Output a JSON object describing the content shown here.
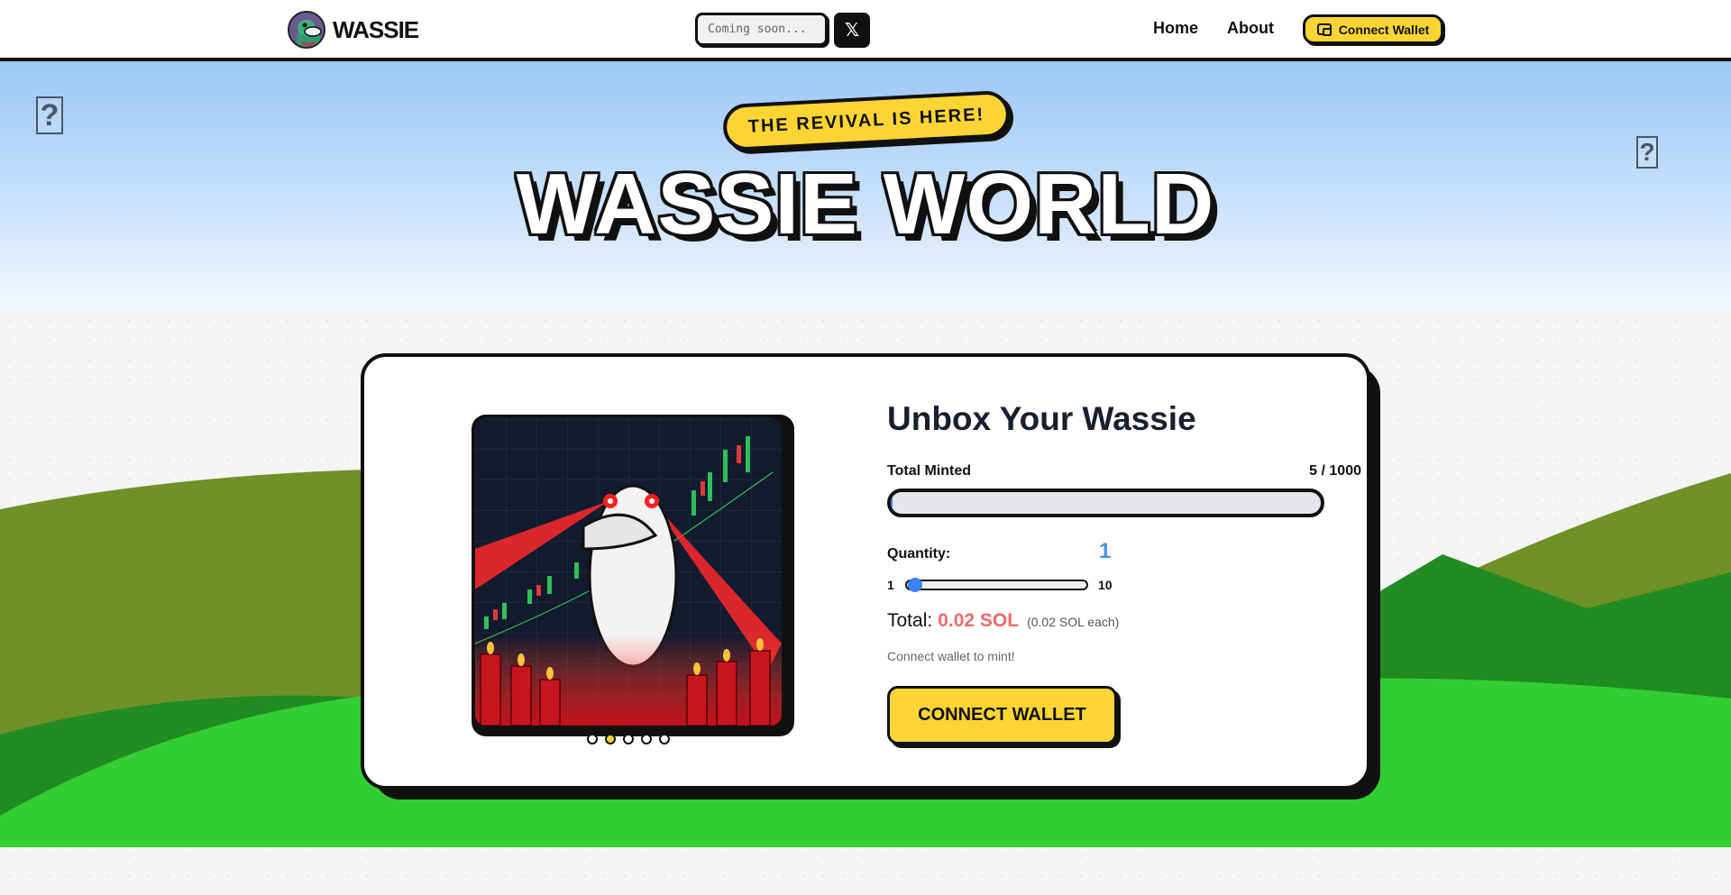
{
  "nav": {
    "brand": "WASSIE",
    "search_placeholder": "Coming soon...",
    "x_label": "𝕏",
    "links": [
      "Home",
      "About"
    ],
    "connect_label": "Connect Wallet"
  },
  "hero": {
    "badge": "THE REVIVAL IS HERE!",
    "title": "WASSIE WORLD",
    "unknown_mark": "?"
  },
  "mint": {
    "title": "Unbox Your Wassie",
    "minted_label": "Total Minted",
    "minted_value": "5 / 1000",
    "minted_fraction": 0.005,
    "quantity_label": "Quantity:",
    "quantity_value": "1",
    "range_min": "1",
    "range_max": "10",
    "slider_fraction": 0.0,
    "total_label": "Total:",
    "total_amount": "0.02 SOL",
    "total_each": "(0.02 SOL each)",
    "hint": "Connect wallet to mint!",
    "connect_button": "CONNECT WALLET",
    "carousel_count": 5,
    "carousel_active": 1
  },
  "colors": {
    "accent_yellow": "#fcd535",
    "accent_blue": "#3b82f6",
    "price_red": "#ef6b6b",
    "outline": "#111111"
  }
}
